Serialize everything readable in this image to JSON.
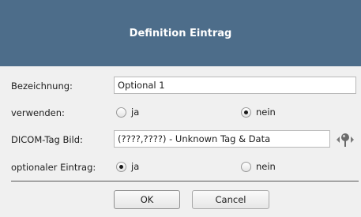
{
  "dialog": {
    "title": "Definition Eintrag",
    "colors": {
      "titlebar": "#4d6d8a",
      "background": "#f0f0f0"
    }
  },
  "form": {
    "bezeichnung": {
      "label": "Bezeichnung:",
      "value": "Optional 1"
    },
    "verwenden": {
      "label": "verwenden:",
      "options": [
        {
          "label": "ja",
          "selected": false
        },
        {
          "label": "nein",
          "selected": true
        }
      ]
    },
    "dicom_tag": {
      "label": "DICOM-Tag Bild:",
      "value": "(????,????) - Unknown Tag & Data",
      "picker_icon": "tag-picker-icon"
    },
    "optionaler_eintrag": {
      "label": "optionaler Eintrag:",
      "options": [
        {
          "label": "ja",
          "selected": true
        },
        {
          "label": "nein",
          "selected": false
        }
      ]
    }
  },
  "buttons": {
    "ok": "OK",
    "cancel": "Cancel"
  }
}
